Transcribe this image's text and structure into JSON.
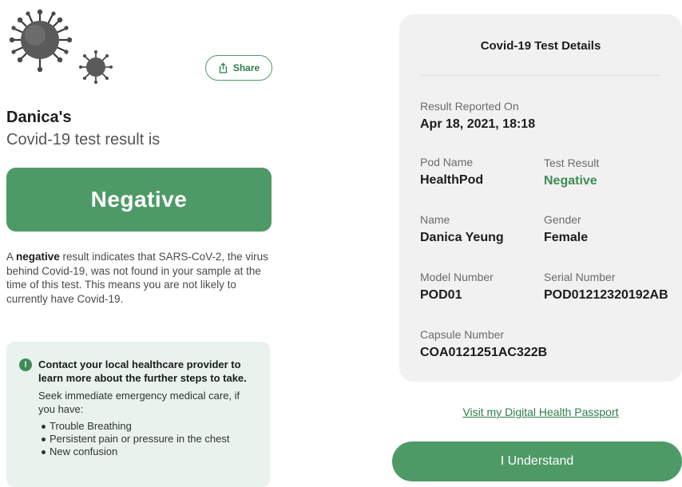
{
  "header": {
    "share_label": "Share"
  },
  "result": {
    "owner": "Danica's",
    "heading": "Covid-19 test result is",
    "banner": "Negative",
    "explain_prefix": "A ",
    "explain_bold": "negative",
    "explain_rest": " result indicates that SARS-CoV-2, the virus behind Covid-19, was not found in your sample at the time of this test. This means you are not likely to currently have Covid-19."
  },
  "advice": {
    "title": "Contact your local healthcare provider to learn more about the further steps to take.",
    "body": "Seek immediate emergency medical care, if you have:",
    "items": [
      "Trouble Breathing",
      "Persistent pain or pressure in the chest",
      "New confusion"
    ]
  },
  "details": {
    "title": "Covid-19 Test Details",
    "reported_label": "Result Reported On",
    "reported_value": "Apr 18, 2021, 18:18",
    "pod_label": "Pod Name",
    "pod_value": "HealthPod",
    "test_result_label": "Test Result",
    "test_result_value": "Negative",
    "name_label": "Name",
    "name_value": "Danica Yeung",
    "gender_label": "Gender",
    "gender_value": "Female",
    "model_label": "Model Number",
    "model_value": "POD01",
    "serial_label": "Serial Number",
    "serial_value": "POD01212320192AB",
    "capsule_label": "Capsule Number",
    "capsule_value": "COA0121251AC322B"
  },
  "footer": {
    "passport_link": "Visit my Digital Health Passport",
    "understand_button": "I Understand"
  },
  "colors": {
    "accent_green": "#4e9a66",
    "text_green": "#3e8b58",
    "advice_bg": "#e9f2ec",
    "card_bg": "#f1f1f1"
  }
}
